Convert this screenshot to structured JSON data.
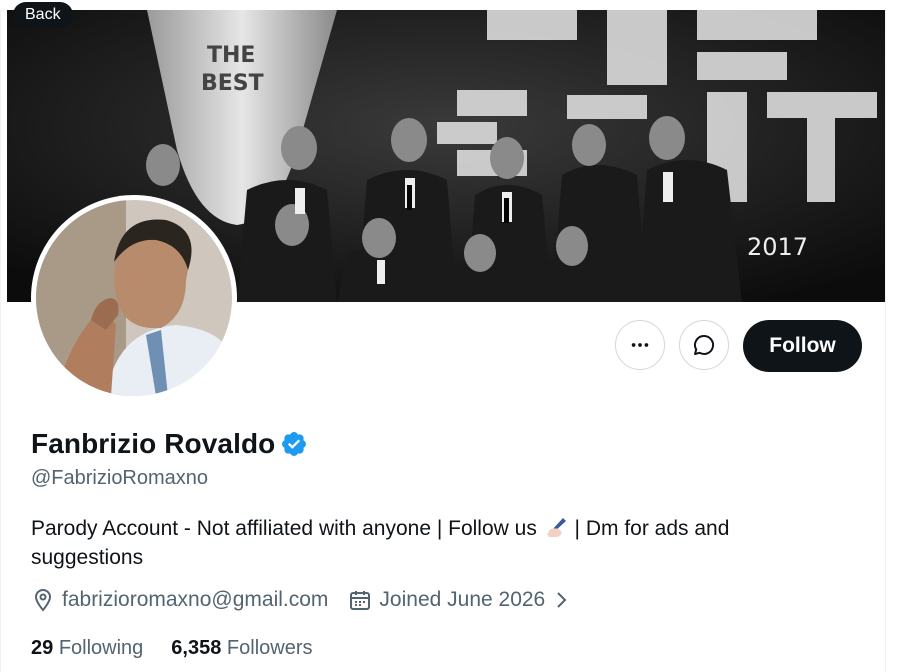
{
  "nav": {
    "back_label": "Back"
  },
  "banner": {
    "year_text": "2017",
    "trophy_text_1": "THE",
    "trophy_text_2": "BEST",
    "big_text_1": "THE",
    "big_text_2": "BEST"
  },
  "actions": {
    "more_icon": "more-icon",
    "message_icon": "message-icon",
    "follow_label": "Follow"
  },
  "profile": {
    "name": "Fanbrizio Rovaldo",
    "handle": "@FabrizioRomaxno",
    "bio_part1": "Parody Account - Not affiliated with anyone | Follow us",
    "bio_part2": "| Dm for ads and suggestions",
    "email": "fabrizioromaxno@gmail.com",
    "joined": "Joined June 2026",
    "following_count": "29",
    "following_label": "Following",
    "followers_count": "6,358",
    "followers_label": "Followers"
  },
  "colors": {
    "verified": "#1d9bf0",
    "primary_text": "#0f1419",
    "secondary_text": "#536471"
  }
}
